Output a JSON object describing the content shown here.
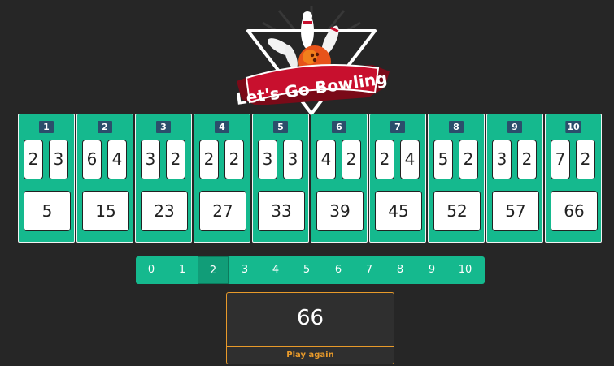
{
  "logo": {
    "text": "Let's Go Bowling"
  },
  "frames": [
    {
      "number": "1",
      "roll1": "2",
      "roll2": "3",
      "score": "5"
    },
    {
      "number": "2",
      "roll1": "6",
      "roll2": "4",
      "score": "15"
    },
    {
      "number": "3",
      "roll1": "3",
      "roll2": "2",
      "score": "23"
    },
    {
      "number": "4",
      "roll1": "2",
      "roll2": "2",
      "score": "27"
    },
    {
      "number": "5",
      "roll1": "3",
      "roll2": "3",
      "score": "33"
    },
    {
      "number": "6",
      "roll1": "4",
      "roll2": "2",
      "score": "39"
    },
    {
      "number": "7",
      "roll1": "2",
      "roll2": "4",
      "score": "45"
    },
    {
      "number": "8",
      "roll1": "5",
      "roll2": "2",
      "score": "52"
    },
    {
      "number": "9",
      "roll1": "3",
      "roll2": "2",
      "score": "57"
    },
    {
      "number": "10",
      "roll1": "7",
      "roll2": "2",
      "score": "66"
    }
  ],
  "pin_selector": {
    "options": [
      "0",
      "1",
      "2",
      "3",
      "4",
      "5",
      "6",
      "7",
      "8",
      "9",
      "10"
    ],
    "selected": "2"
  },
  "total": {
    "value": "66",
    "play_again_label": "Play again"
  },
  "colors": {
    "background": "#262626",
    "frame": "#15b98e",
    "badge": "#2b4e6b",
    "accent": "#e89a2a",
    "ribbon": "#c8102e"
  }
}
